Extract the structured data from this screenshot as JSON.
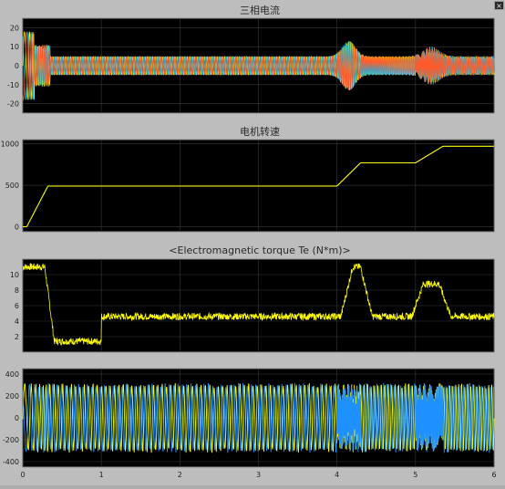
{
  "window": {
    "close_glyph": "×"
  },
  "plots": [
    {
      "id": "current",
      "title": "三相电流",
      "yticks": [
        "20",
        "10",
        "0",
        "-10",
        "-20"
      ],
      "ylim": [
        -25,
        25
      ],
      "tick_values": [
        20,
        10,
        0,
        -10,
        -20
      ],
      "series_colors": [
        "#ffff00",
        "#00bfff",
        "#ff5a2a"
      ]
    },
    {
      "id": "speed",
      "title": "电机转速",
      "yticks": [
        "1000",
        "500",
        "0"
      ],
      "ylim": [
        -60,
        1050
      ],
      "tick_values": [
        1000,
        500,
        0
      ],
      "series_colors": [
        "#ffff00"
      ]
    },
    {
      "id": "torque",
      "title": "<Electromagnetic torque Te (N*m)>",
      "yticks": [
        "10",
        "8",
        "6",
        "4",
        "2"
      ],
      "ylim": [
        0,
        12
      ],
      "tick_values": [
        10,
        8,
        6,
        4,
        2
      ],
      "series_colors": [
        "#ffff00"
      ]
    },
    {
      "id": "voltage",
      "title": "",
      "yticks": [
        "400",
        "200",
        "0",
        "-200",
        "-400"
      ],
      "ylim": [
        -450,
        450
      ],
      "tick_values": [
        400,
        200,
        0,
        -200,
        -400
      ],
      "series_colors": [
        "#ffff00",
        "#1e90ff"
      ]
    }
  ],
  "xaxis": {
    "ticks": [
      "0",
      "1",
      "2",
      "3",
      "4",
      "5",
      "6"
    ],
    "values": [
      0,
      1,
      2,
      3,
      4,
      5,
      6
    ],
    "xlim": [
      0,
      6
    ]
  },
  "colors": {
    "plot_bg": "#000000",
    "grid": "#3a3a3a",
    "text": "#1f1f1f",
    "frame": "#9a9a9a"
  }
}
